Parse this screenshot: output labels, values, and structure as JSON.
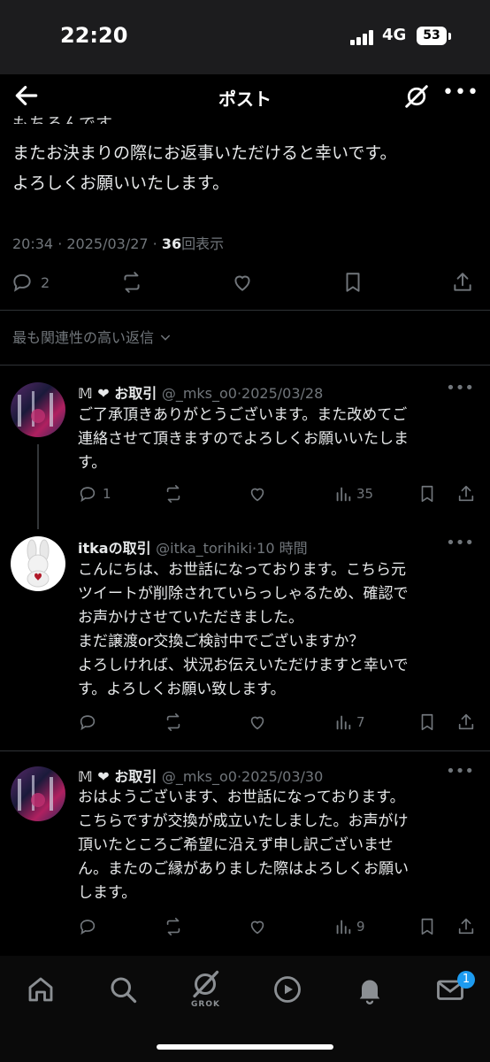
{
  "status_bar": {
    "time": "22:20",
    "network": "4G",
    "battery": "53"
  },
  "nav": {
    "title": "ポスト"
  },
  "post": {
    "partial_line": "もちろんです。",
    "lines": [
      "またお決まりの際にお返事いただけると幸いです。",
      "よろしくお願いいたします。"
    ],
    "meta_time": "20:34 · 2025/03/27 · ",
    "views": "36",
    "views_label": "回表示",
    "reply_count": "2"
  },
  "sort_label": "最も関連性の高い返信",
  "replies": [
    {
      "name": "𝕄 ❤ お取引",
      "handle": "@_mks_o0·2025/03/28",
      "text": "ご了承頂きありがとうございます。また改めてご\n連絡させて頂きますのでよろしくお願いいたしま\nす。",
      "replies": "1",
      "views": "35"
    },
    {
      "name": "itkaの取引",
      "handle": "@itka_torihiki·10 時間",
      "text": "こんにちは、お世話になっております。こちら元\nツイートが削除されていらっしゃるため、確認で\nお声かけさせていただきました。\nまだ譲渡or交換ご検討中でございますか？\nよろしければ、状況お伝えいただけますと幸いで\nす。よろしくお願い致します。",
      "replies": "",
      "views": "7"
    },
    {
      "name": "𝕄 ❤ お取引",
      "handle": "@_mks_o0·2025/03/30",
      "text": "おはようございます、お世話になっております。\nこちらですが交換が成立いたしました。お声がけ\n頂いたところご希望に沿えず申し訳ございませ\nん。またのご縁がありました際はよろしくお願い\nします。",
      "replies": "",
      "views": "9"
    }
  ],
  "tabbar": {
    "grok_label": "GROK",
    "messages_badge": "1"
  },
  "colors": {
    "background": "#000000",
    "text": "#e7e9ea",
    "muted": "#71767b",
    "accent": "#1d9bf0"
  }
}
